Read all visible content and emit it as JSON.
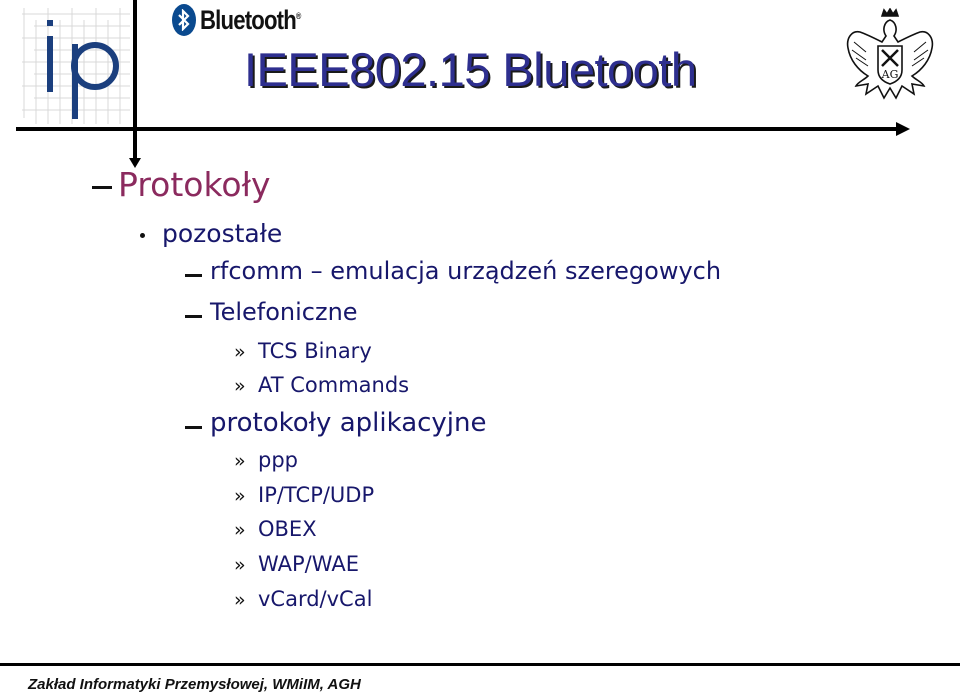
{
  "header": {
    "title": "IEEE802.15 Bluetooth",
    "brand_logo_text": "Bluetooth",
    "brand_logo_mark": "®",
    "left_logo": "ip-logo",
    "right_logo": "eagle-emblem-icon"
  },
  "content": {
    "heading": "Protokoły",
    "level2": "pozostałe",
    "items": [
      {
        "level": 3,
        "text": "rfcomm – emulacja urządzeń szeregowych"
      },
      {
        "level": 3,
        "text": "Telefoniczne"
      },
      {
        "level": 4,
        "marker": "»",
        "text": "TCS Binary"
      },
      {
        "level": 4,
        "marker": "»",
        "text": "AT Commands"
      },
      {
        "level": 3,
        "text": "protokoły aplikacyjne"
      },
      {
        "level": 4,
        "marker": "»",
        "text": "ppp"
      },
      {
        "level": 4,
        "marker": "»",
        "text": "IP/TCP/UDP"
      },
      {
        "level": 4,
        "marker": "»",
        "text": "OBEX"
      },
      {
        "level": 4,
        "marker": "»",
        "text": "WAP/WAE"
      },
      {
        "level": 4,
        "marker": "»",
        "text": "vCard/vCal"
      }
    ]
  },
  "footer": {
    "text": "Zakład Informatyki Przemysłowej, WMiIM, AGH"
  },
  "colors": {
    "title": "#2e2f8f",
    "heading": "#8b2a5e",
    "body_text": "#17176b",
    "logo_blue": "#0a4a8f"
  }
}
